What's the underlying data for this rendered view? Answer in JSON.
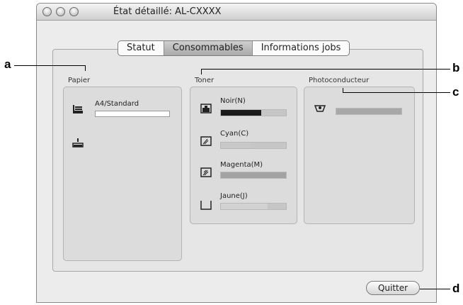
{
  "window": {
    "title": "État détaillé: AL-CXXXX"
  },
  "tabs": [
    {
      "label": "Statut",
      "active": false
    },
    {
      "label": "Consommables",
      "active": true
    },
    {
      "label": "Informations jobs",
      "active": false
    }
  ],
  "paper": {
    "label": "Papier",
    "trays": [
      {
        "icon": "paper-tray-icon",
        "label": "A4/Standard"
      },
      {
        "icon": "paper-tray-empty-icon",
        "label": ""
      }
    ]
  },
  "toner": {
    "label": "Toner",
    "items": [
      {
        "icon": "toner-black-icon",
        "label": "Noir(N)",
        "level": 0.62,
        "color": "#1a1a1a"
      },
      {
        "icon": "toner-cyan-icon",
        "label": "Cyan(C)",
        "level": 0.45,
        "color": "#c9c9c9"
      },
      {
        "icon": "toner-magenta-icon",
        "label": "Magenta(M)",
        "level": 1.0,
        "color": "#a3a3a3"
      },
      {
        "icon": "toner-yellow-icon",
        "label": "Jaune(J)",
        "level": 0.72,
        "color": "#d2d2d2"
      }
    ]
  },
  "photoconductor": {
    "label": "Photoconducteur",
    "icon": "photoconductor-icon",
    "level": 1.0,
    "color": "#a8a8a8"
  },
  "footer": {
    "quit_label": "Quitter"
  },
  "callouts": [
    "a",
    "b",
    "c",
    "d"
  ]
}
